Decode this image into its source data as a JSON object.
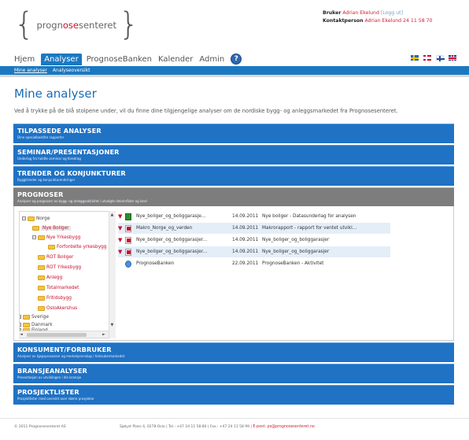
{
  "logo": {
    "brace_left": "{",
    "part1": "progn",
    "part2": "o",
    "part3": "se",
    "part4": "senteret",
    "brace_right": "}"
  },
  "user": {
    "bruker_label": "Bruker",
    "bruker_name": "Adrian Ekelund",
    "logout": "[Logg ut]",
    "kontakt_label": "Kontaktperson",
    "kontakt_value": "Adrian Ekelund 24 11 58 70"
  },
  "topnav": {
    "items": [
      "Hjem",
      "Analyser",
      "PrognoseBanken",
      "Kalender",
      "Admin"
    ],
    "active": "Analyser",
    "help": "?"
  },
  "flags": [
    "sweden-flag",
    "norway-flag",
    "finland-flag",
    "uk-flag"
  ],
  "subnav": {
    "items": [
      "Mine analyser",
      "Analyseoversikt"
    ]
  },
  "page": {
    "title": "Mine analyser",
    "intro": "Ved å trykke på de blå stolpene under, vil du finne dine tilgjengelige analyser om de nordiske bygg- og anleggsmarkedet fra Prognosesenteret."
  },
  "sections": [
    {
      "title": "TILPASSEDE ANALYSER",
      "desc": "Dine spesialbestilte rapporter"
    },
    {
      "title": "SEMINAR/PRESENTASJONER",
      "desc": "Underlag fra holdte seminar og foredrag"
    },
    {
      "title": "TRENDER OG KONJUNKTURER",
      "desc": "Byggtrender og konjunkturendringer"
    },
    {
      "title": "PROGNOSER",
      "desc": "Analyser og prognoser av bygg- og anleggsaktivitet i utvalgte delområder og land"
    },
    {
      "title": "KONSUMENT/FORBRUKER",
      "desc": "Analyser av kjøpsprosesser og merkekjennskap i forbrukermarkedet"
    },
    {
      "title": "BRANSJEANALYSER",
      "desc": "Presentasjon av utviklingen i din bransje"
    },
    {
      "title": "PROSJEKTLISTER",
      "desc": "Prosjektlister med oversikt over større prosjekter"
    }
  ],
  "tree": {
    "norge": "Norge",
    "nye_boliger": "Nye Boliger",
    "nye_yrkesbygg": "Nye Yrkesbygg",
    "forfordelte": "Forfordelte yrkesbygg",
    "rot_boliger": "ROT Boliger",
    "rot_yrkesbygg": "ROT Yrkesbygg",
    "anlegg": "Anlegg",
    "totalmarkedet": "Totalmarkedet",
    "fritidsbygg": "Fritidsbygg",
    "osloakershus": "OsloAkershus",
    "sverige": "Sverige",
    "danmark": "Danmark",
    "finland": "Finland",
    "plus": "+",
    "minus": "−",
    "arrow_up": "▲",
    "arrow_down": "▼",
    "arrow_left": "◄",
    "arrow_right": "►"
  },
  "files": [
    {
      "name": "Nye_boliger_og_boliggarasje...",
      "date": "14.09.2011",
      "desc": "Nye boliger - Datasunderlag for analysen",
      "icon": "xls-icon"
    },
    {
      "name": "Makro_Norge_og_verden",
      "date": "14.09.2011",
      "desc": "Makrorapport - rapport for ventet utvikl...",
      "icon": "pdf-icon"
    },
    {
      "name": "Nye_boliger_og_boliggarasjer...",
      "date": "14.09.2011",
      "desc": "Nye_boliger_og_boliggarasjer",
      "icon": "pdf-icon"
    },
    {
      "name": "Nye_boliger_og_boliggarasjer...",
      "date": "14.09.2011",
      "desc": "Nye_boliger_og_boliggarasjer",
      "icon": "pdf-icon"
    },
    {
      "name": "PrognoseBanken",
      "date": "22.09.2011",
      "desc": "PrognoseBanken - Aktivitet",
      "icon": "web-icon"
    }
  ],
  "pin_glyph": "▼",
  "footer": {
    "copyright": "© 2011 Prognosesenteret AS",
    "address": "Sjølyst Plass 4, 0278 Oslo  |  Tel.: +47 24 11 58 80  |  Fax.: +47 24 11 58 99  |",
    "email": "E-post: ps@prognosesenteret.no"
  }
}
